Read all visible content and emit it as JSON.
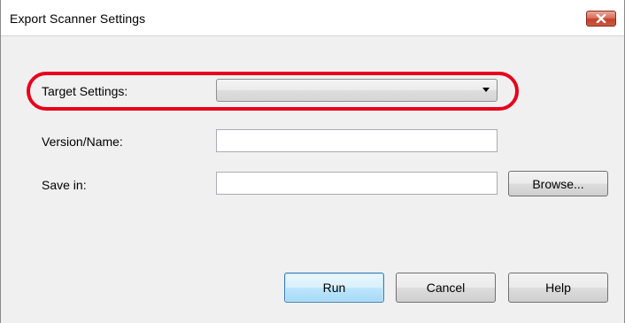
{
  "window": {
    "title": "Export Scanner Settings",
    "close_tooltip": "Close"
  },
  "form": {
    "target_settings": {
      "label": "Target Settings:",
      "selected_value": "",
      "highlight_color": "#e8001c"
    },
    "version_name": {
      "label": "Version/Name:",
      "value": ""
    },
    "save_in": {
      "label": "Save in:",
      "value": ""
    },
    "browse_label": "Browse..."
  },
  "buttons": {
    "run": "Run",
    "cancel": "Cancel",
    "help": "Help"
  },
  "icons": {
    "close": "close-icon",
    "dropdown": "chevron-down-icon"
  }
}
